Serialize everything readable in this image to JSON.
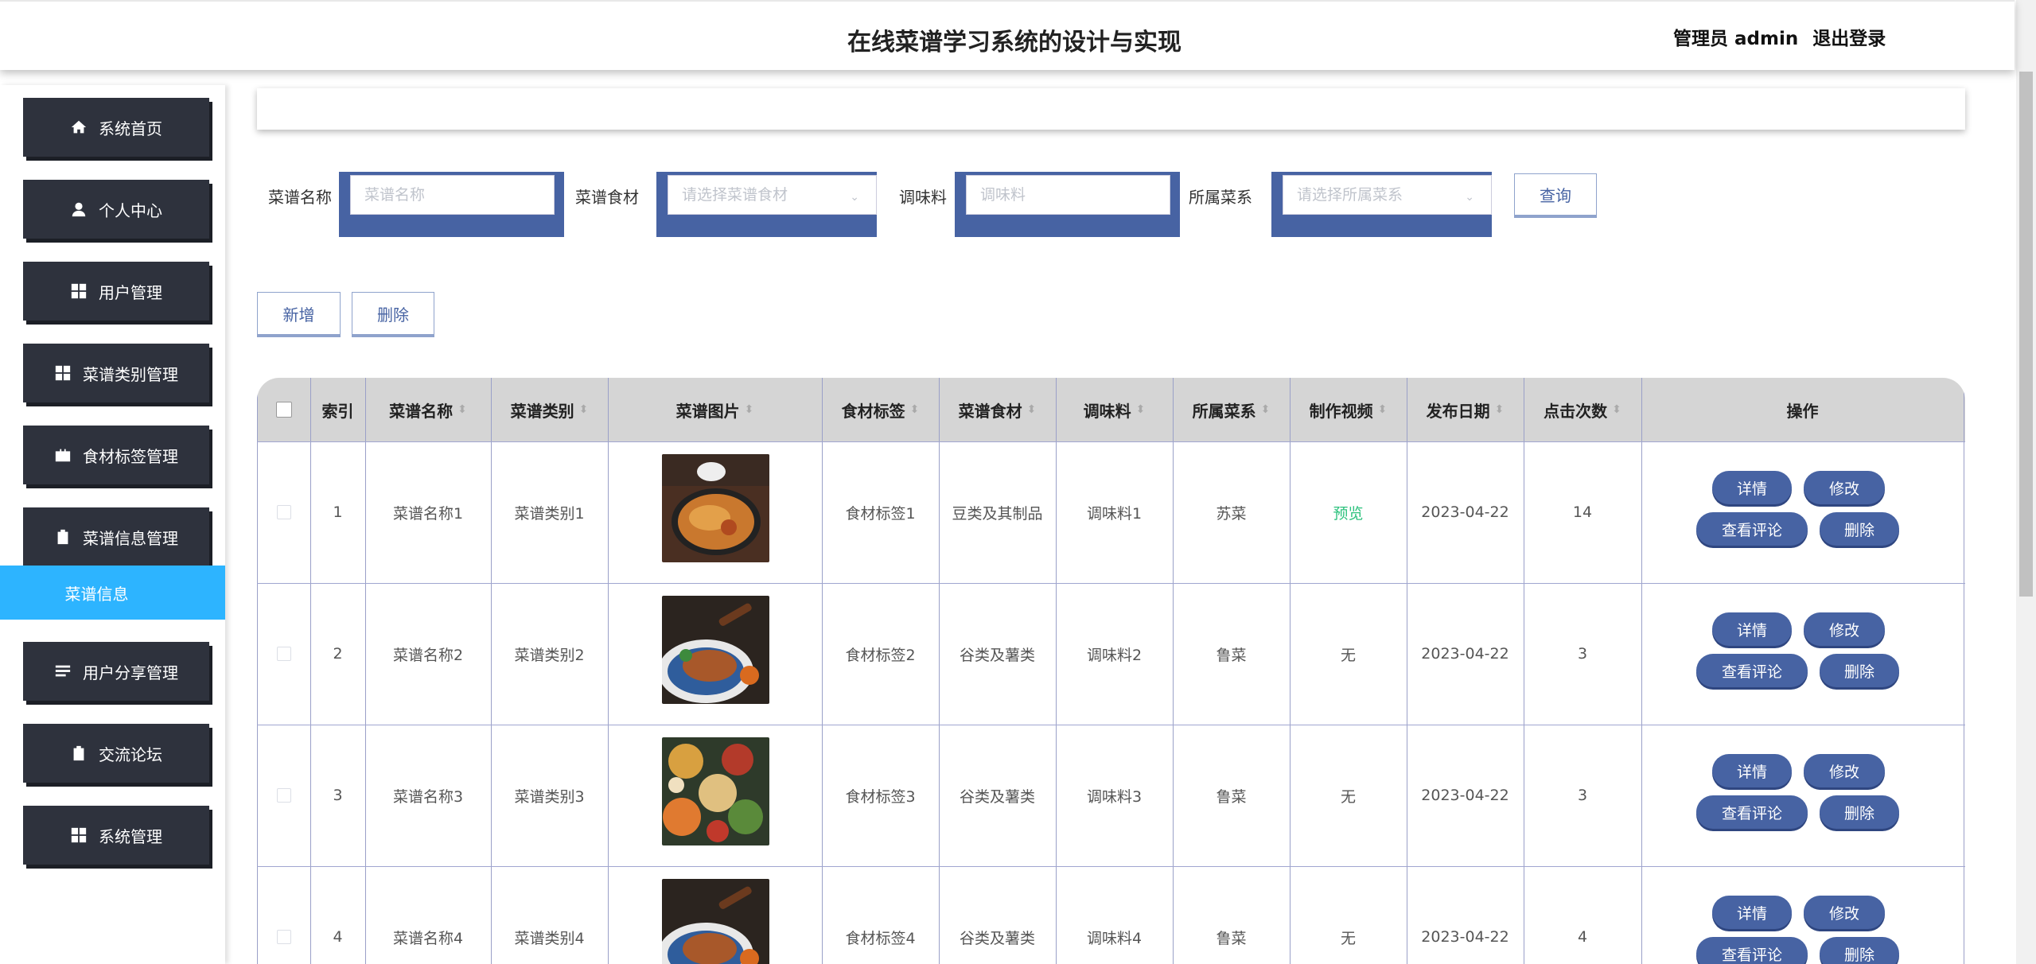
{
  "header": {
    "title": "在线菜谱学习系统的设计与实现",
    "user_label": "管理员 admin",
    "logout": "退出登录"
  },
  "sidebar": {
    "items": [
      {
        "label": "系统首页",
        "icon": "home-icon"
      },
      {
        "label": "个人中心",
        "icon": "person-icon"
      },
      {
        "label": "用户管理",
        "icon": "grid-icon"
      },
      {
        "label": "菜谱类别管理",
        "icon": "grid-icon"
      },
      {
        "label": "食材标签管理",
        "icon": "briefcase-icon"
      },
      {
        "label": "菜谱信息管理",
        "icon": "clipboard-icon"
      },
      {
        "label": "用户分享管理",
        "icon": "list-icon"
      },
      {
        "label": "交流论坛",
        "icon": "clipboard-check-icon"
      },
      {
        "label": "系统管理",
        "icon": "grid-icon"
      }
    ],
    "active_sub": "菜谱信息"
  },
  "search": {
    "name_label": "菜谱名称",
    "name_placeholder": "菜谱名称",
    "ingredient_label": "菜谱食材",
    "ingredient_placeholder": "请选择菜谱食材",
    "seasoning_label": "调味料",
    "seasoning_placeholder": "调味料",
    "cuisine_label": "所属菜系",
    "cuisine_placeholder": "请选择所属菜系",
    "query_button": "查询"
  },
  "actions": {
    "add": "新增",
    "delete": "删除"
  },
  "table": {
    "headers": [
      "索引",
      "菜谱名称",
      "菜谱类别",
      "菜谱图片",
      "食材标签",
      "菜谱食材",
      "调味料",
      "所属菜系",
      "制作视频",
      "发布日期",
      "点击次数",
      "操作"
    ],
    "rows": [
      {
        "index": "1",
        "name": "菜谱名称1",
        "category": "菜谱类别1",
        "tag": "食材标签1",
        "ingredient": "豆类及其制品",
        "seasoning": "调味料1",
        "cuisine": "苏菜",
        "video": "预览",
        "date": "2023-04-22",
        "clicks": "14"
      },
      {
        "index": "2",
        "name": "菜谱名称2",
        "category": "菜谱类别2",
        "tag": "食材标签2",
        "ingredient": "谷类及薯类",
        "seasoning": "调味料2",
        "cuisine": "鲁菜",
        "video": "无",
        "date": "2023-04-22",
        "clicks": "3"
      },
      {
        "index": "3",
        "name": "菜谱名称3",
        "category": "菜谱类别3",
        "tag": "食材标签3",
        "ingredient": "谷类及薯类",
        "seasoning": "调味料3",
        "cuisine": "鲁菜",
        "video": "无",
        "date": "2023-04-22",
        "clicks": "3"
      },
      {
        "index": "4",
        "name": "菜谱名称4",
        "category": "菜谱类别4",
        "tag": "食材标签4",
        "ingredient": "谷类及薯类",
        "seasoning": "调味料4",
        "cuisine": "鲁菜",
        "video": "无",
        "date": "2023-04-22",
        "clicks": "4"
      }
    ],
    "row_buttons": {
      "detail": "详情",
      "edit": "修改",
      "comments": "查看评论",
      "delete": "删除"
    }
  },
  "colors": {
    "sidebar": "#2e323d",
    "active": "#2db4ff",
    "primary": "#4763a3"
  }
}
